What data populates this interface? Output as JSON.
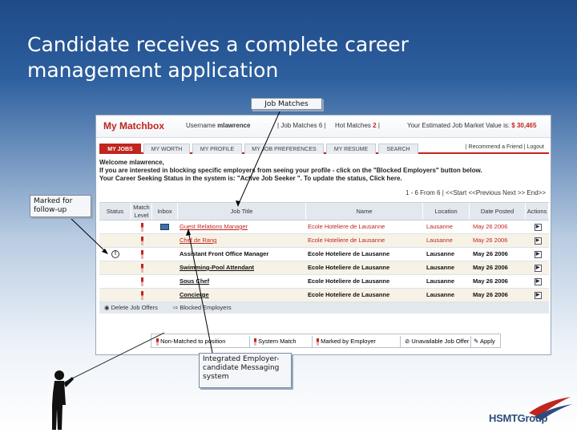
{
  "slide": {
    "title_line1": "Candidate receives a complete career",
    "title_line2": "management application"
  },
  "callouts": {
    "job_matches": "Job Matches",
    "followup_line1": "Marked for",
    "followup_line2": "follow-up",
    "messaging_line1": "Integrated Employer-",
    "messaging_line2": "candidate Messaging",
    "messaging_line3": "system"
  },
  "app": {
    "title": "My Matchbox",
    "user_label": "Username",
    "user_name": "mlawrence",
    "job_matches_label": "Job Matches",
    "job_matches_count": "6",
    "hot_matches_label": "Hot Matches",
    "hot_matches_count": "2",
    "market_value_label": "Your Estimated Job Market Value is:",
    "market_value": "$ 30,465",
    "tabs": [
      "MY JOBS",
      "MY WORTH",
      "MY PROFILE",
      "MY JOB PREFERENCES",
      "MY RESUME",
      "SEARCH"
    ],
    "top_links": {
      "recommend": "Recommend a Friend",
      "logout": "Logout"
    },
    "welcome_line1": "Welcome mlawrence,",
    "welcome_line2": "If you are interested in blocking specific employers from seeing your profile - click on the \"Blocked Employers\" button below.",
    "welcome_line3": "Your Career Seeking Status in the system is: \"Active Job Seeker \". To update the status, Click here.",
    "pager": "1 - 6 From 6 | <<Start <<Previous      Next >> End>>",
    "columns": {
      "status": "Status",
      "match_level_1": "Match",
      "match_level_2": "Level",
      "inbox": "Inbox",
      "job_title": "Job Title",
      "name": "Name",
      "location": "Location",
      "date_posted": "Date Posted",
      "actions": "Actions"
    },
    "rows": [
      {
        "title": "Guest Relations Manager",
        "name": "Ecole Hoteliere de Lausanne",
        "location": "Lausanne",
        "date": "May 26 2006",
        "status": "",
        "inbox": true
      },
      {
        "title": "Chef de Rang",
        "name": "Ecole Hoteliere de Lausanne",
        "location": "Lausanne",
        "date": "May 26 2006",
        "status": "",
        "inbox": false
      },
      {
        "title": "Assistant Front Office Manager",
        "name": "Ecole Hoteliere de Lausanne",
        "location": "Lausanne",
        "date": "May 26 2006",
        "status": "!",
        "inbox": false
      },
      {
        "title": "Swimming-Pool Attendant",
        "name": "Ecole Hoteliere de Lausanne",
        "location": "Lausanne",
        "date": "May 26 2006",
        "status": "",
        "inbox": false
      },
      {
        "title": "Sous Chef",
        "name": "Ecole Hoteliere de Lausanne",
        "location": "Lausanne",
        "date": "May 26 2006",
        "status": "",
        "inbox": false
      },
      {
        "title": "Concierge",
        "name": "Ecole Hoteliere de Lausanne",
        "location": "Lausanne",
        "date": "May 26 2006",
        "status": "",
        "inbox": false
      }
    ],
    "footer": {
      "delete": "Delete Job Offers",
      "blocked": "Blocked Employers"
    },
    "legend": {
      "non_matched": "Non-Matched to position",
      "system_match": "System Match",
      "marked_by_employer": "Marked by Employer",
      "unavailable": "Unavailable Job Offer",
      "apply": "Apply"
    }
  },
  "branding": {
    "logo": "HSMTGroup"
  },
  "colors": {
    "brand_red": "#c0251e",
    "header_blue": "#1f4a88"
  }
}
